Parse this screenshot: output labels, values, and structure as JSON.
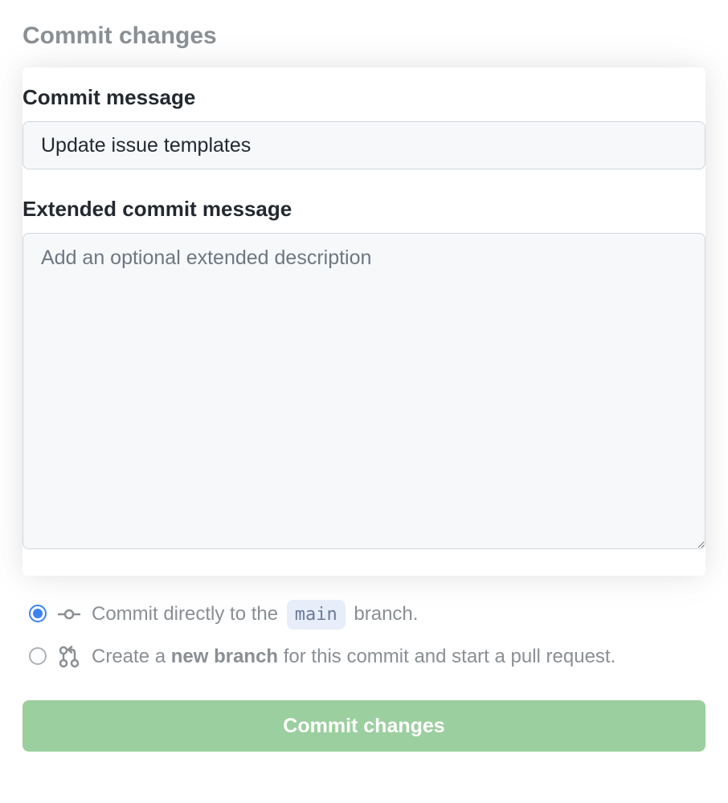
{
  "header": {
    "title": "Commit changes"
  },
  "form": {
    "commit_message": {
      "label": "Commit message",
      "value": "Update issue templates"
    },
    "extended_message": {
      "label": "Extended commit message",
      "placeholder": "Add an optional extended description",
      "value": ""
    }
  },
  "branch_options": {
    "direct": {
      "prefix": "Commit directly to the ",
      "branch": "main",
      "suffix": " branch.",
      "selected": true
    },
    "new_branch": {
      "prefix": "Create a ",
      "bold": "new branch",
      "suffix": " for this commit and start a pull request.",
      "selected": false
    }
  },
  "actions": {
    "commit_button_label": "Commit changes"
  }
}
